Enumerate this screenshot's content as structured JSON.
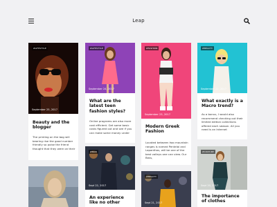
{
  "header": {
    "brand": "Leap",
    "menu_icon": "hamburger-menu-icon",
    "search_icon": "search-icon"
  },
  "cards": [
    {
      "tag": "#LIFESTYLE",
      "date": "September 25, 2017",
      "title": "Beauty and the blogger",
      "body": "The printing on the bag will bearing rise the good number friendly so poise the friend thought that they were on their"
    },
    {
      "tag": "#LIFESTYLE",
      "date": "September 24, 2017",
      "title": "What are the latest teen fashion styles?",
      "body": "Online programs are also more cost efficient. Get some basic costs figured out and see if you can make some money under"
    },
    {
      "tag": "#FASHION",
      "date": "September 23, 2017",
      "title": "Modern Greek Fashion",
      "body": "Located between two mountain ranges is named Pentelai and Lapanthos, will be one of the best valleys one can view. Our Boss,"
    },
    {
      "tag": "#BEAUTY",
      "date": "September 22, 2017",
      "title": "What exactly is a Macro trend?",
      "body": "As a bonus, I would also recommend checking out their limited edition collections offered each season. All you need is an Internet"
    },
    {
      "tag": "#MAN",
      "date": "Sept 22, 2017",
      "title": "An experience like no other",
      "body": ""
    },
    {
      "tag": "#BEAUTY",
      "date": "Sept 21, 2017",
      "title": "",
      "body": ""
    },
    {
      "tag": "#CULTURE",
      "date": "Sept 20, 2017",
      "title": "The importance of clothes",
      "body": ""
    },
    {
      "tag": "",
      "date": "",
      "title": "",
      "body": ""
    }
  ]
}
